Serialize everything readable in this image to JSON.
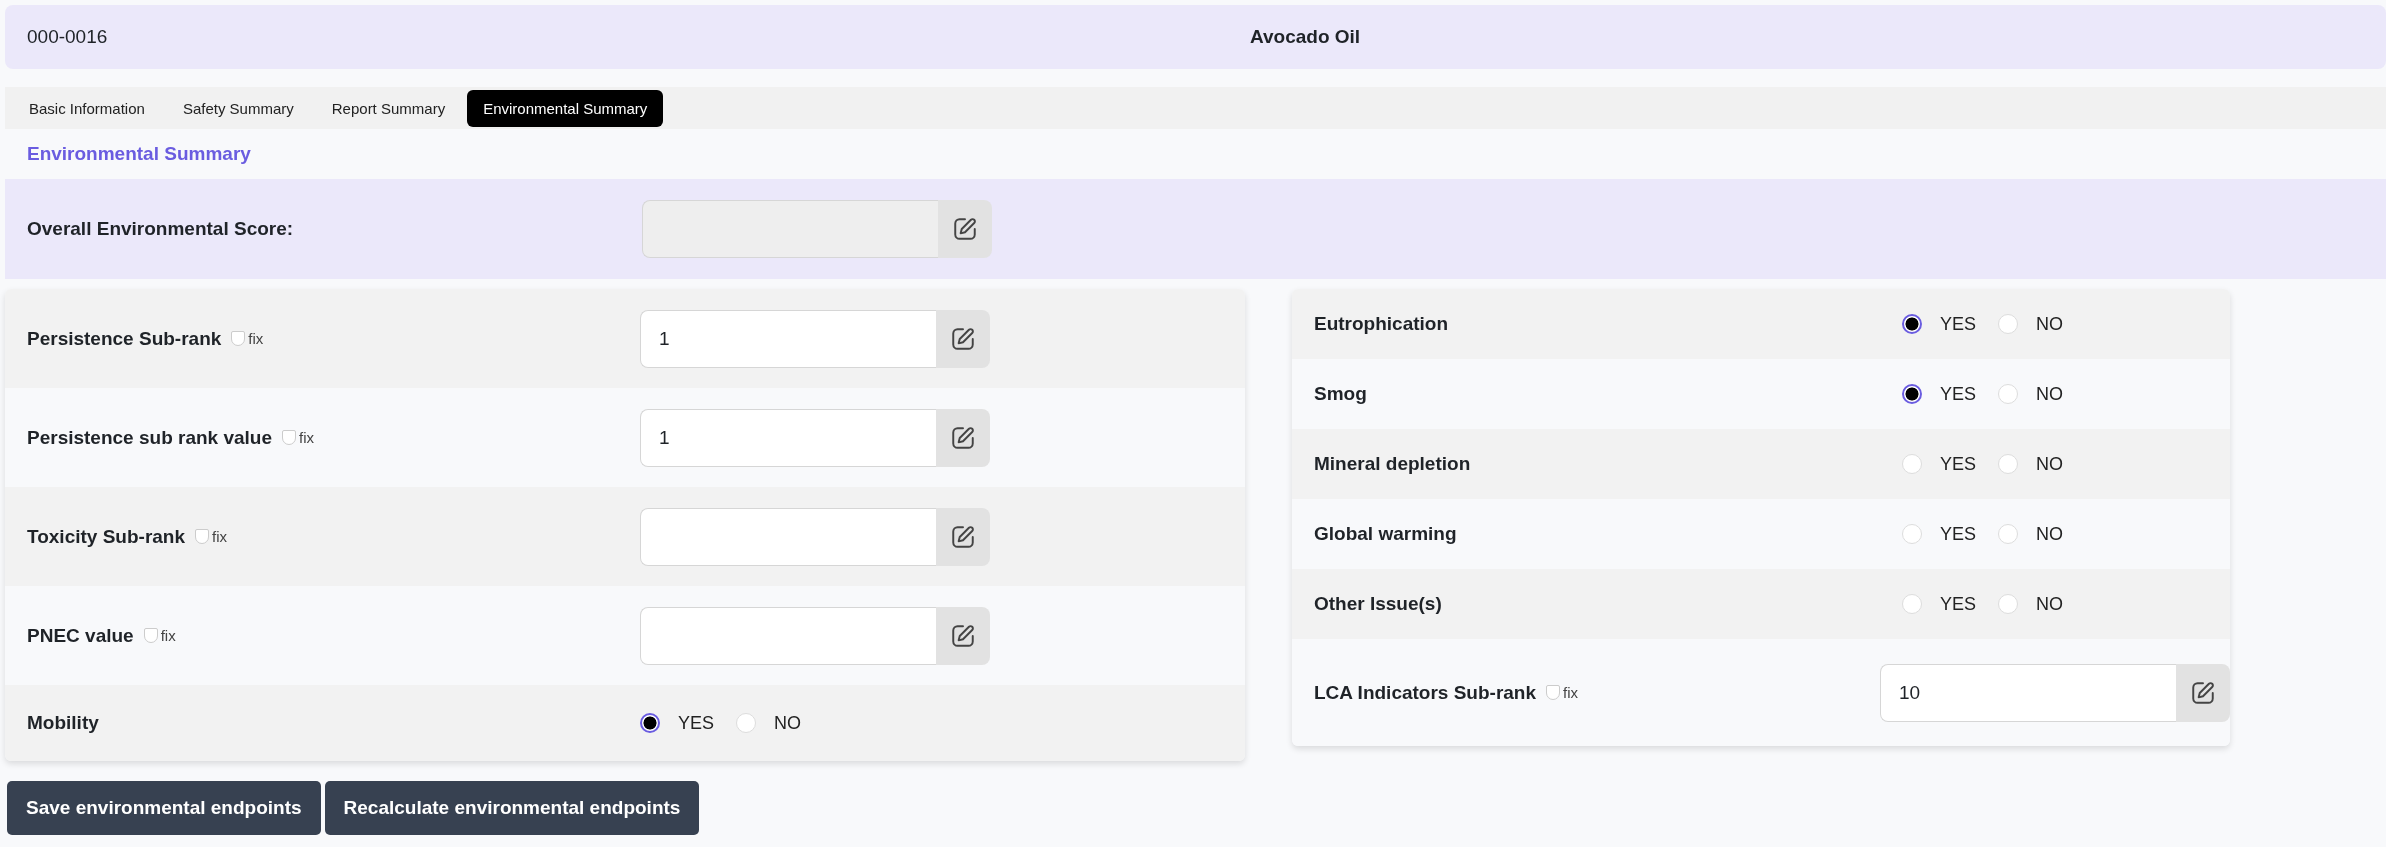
{
  "header": {
    "code": "000-0016",
    "name": "Avocado Oil"
  },
  "tabs": [
    {
      "label": "Basic Information",
      "selected": false
    },
    {
      "label": "Safety Summary",
      "selected": false
    },
    {
      "label": "Report Summary",
      "selected": false
    },
    {
      "label": "Environmental Summary",
      "selected": true
    }
  ],
  "section_title": "Environmental Summary",
  "overall": {
    "label": "Overall Environmental Score:",
    "disabled": true
  },
  "left_rows": [
    {
      "kind": "field",
      "label": "Persistence Sub-rank",
      "fix": {
        "label": "fix",
        "checked": false
      },
      "value": "1"
    },
    {
      "kind": "field",
      "label": "Persistence sub rank value",
      "fix": {
        "label": "fix",
        "checked": false
      },
      "value": "1"
    },
    {
      "kind": "field",
      "label": "Toxicity Sub-rank",
      "fix": {
        "label": "fix",
        "checked": false
      }
    },
    {
      "kind": "field",
      "label": "PNEC value",
      "fix": {
        "label": "fix",
        "checked": false
      }
    },
    {
      "kind": "radio",
      "label": "Mobility",
      "options": [
        {
          "label": "YES",
          "selected": true
        },
        {
          "label": "NO",
          "selected": false
        }
      ]
    }
  ],
  "right_rows": [
    {
      "kind": "radio",
      "label": "Eutrophication",
      "options": [
        {
          "label": "YES",
          "selected": true
        },
        {
          "label": "NO",
          "selected": false
        }
      ]
    },
    {
      "kind": "radio",
      "label": "Smog",
      "options": [
        {
          "label": "YES",
          "selected": true
        },
        {
          "label": "NO",
          "selected": false
        }
      ]
    },
    {
      "kind": "radio",
      "label": "Mineral depletion",
      "options": [
        {
          "label": "YES",
          "selected": false
        },
        {
          "label": "NO",
          "selected": false
        }
      ]
    },
    {
      "kind": "radio",
      "label": "Global warming",
      "options": [
        {
          "label": "YES",
          "selected": false
        },
        {
          "label": "NO",
          "selected": false
        }
      ]
    },
    {
      "kind": "radio",
      "label": "Other Issue(s)",
      "options": [
        {
          "label": "YES",
          "selected": false
        },
        {
          "label": "NO",
          "selected": false
        }
      ]
    },
    {
      "kind": "field",
      "label": "LCA Indicators Sub-rank",
      "fix": {
        "label": "fix",
        "checked": false
      },
      "value": "10"
    }
  ],
  "buttons": [
    "Save environmental endpoints",
    "Recalculate environmental endpoints"
  ]
}
